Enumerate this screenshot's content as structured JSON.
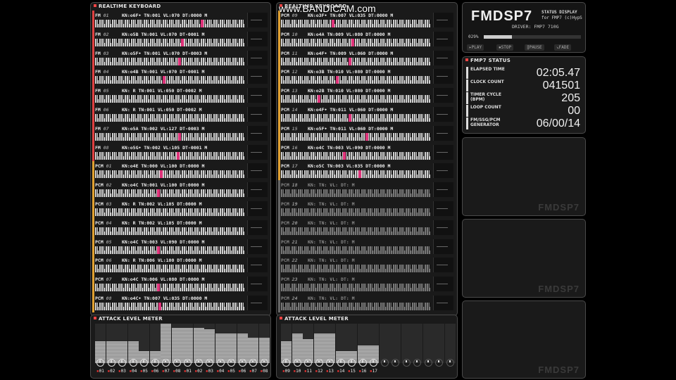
{
  "watermark": "www.BANDICAM.com",
  "left_panel": {
    "title": "REALTIME KEYBOARD",
    "rows": [
      {
        "ch": "FM",
        "num": "01",
        "info": "KN:o6F• TN:001 VL:070 DT:0000 M",
        "color": "#e04040",
        "keys": [
          150
        ]
      },
      {
        "ch": "FM",
        "num": "02",
        "info": "KN:o5B  TN:001 VL:070 DT-0001 M",
        "color": "#e04040",
        "keys": [
          122
        ]
      },
      {
        "ch": "FM",
        "num": "03",
        "info": "KN:o5F• TN:001 VL:070 DT-0003 M",
        "color": "#e04040",
        "keys": [
          118
        ]
      },
      {
        "ch": "FM",
        "num": "04",
        "info": "KN:o4B  TN:001 VL:070 DT-0001 M",
        "color": "#e04040",
        "keys": [
          96
        ]
      },
      {
        "ch": "FM",
        "num": "05",
        "info": "KN: R   TN:001 VL:050 DT-0002 M",
        "color": "#e04040",
        "keys": []
      },
      {
        "ch": "FM",
        "num": "06",
        "info": "KN: R   TN:001 VL:050 DT-0002 M",
        "color": "#e04040",
        "keys": []
      },
      {
        "ch": "FM",
        "num": "07",
        "info": "KN:o5A  TN:002 VL:127 DT-0003 M",
        "color": "#e04040",
        "keys": [
          118
        ]
      },
      {
        "ch": "FM",
        "num": "08",
        "info": "KN:o5G• TN:002 VL:105 DT-0001 M",
        "color": "#e04040",
        "keys": [
          116
        ]
      },
      {
        "ch": "PCM",
        "num": "01",
        "info": "KN:o4E  TN:000 VL:100 DT:0000 M",
        "color": "#e0a030",
        "keys": [
          92
        ]
      },
      {
        "ch": "PCM",
        "num": "02",
        "info": "KN:o4C  TN:001 VL:100 DT:0000 M",
        "color": "#e0a030",
        "keys": [
          88
        ]
      },
      {
        "ch": "PCM",
        "num": "03",
        "info": "KN: R   TN:002 VL:105 DT:0000 M",
        "color": "#e0a030",
        "keys": []
      },
      {
        "ch": "PCM",
        "num": "04",
        "info": "KN: R   TN:002 VL:105 DT:0000 M",
        "color": "#e0a030",
        "keys": []
      },
      {
        "ch": "PCM",
        "num": "05",
        "info": "KN:o4C  TN:003 VL:090 DT:0000 M",
        "color": "#e0a030",
        "keys": [
          88
        ]
      },
      {
        "ch": "PCM",
        "num": "06",
        "info": "KN: R   TN:006 VL:100 DT:0000 M",
        "color": "#e0a030",
        "keys": []
      },
      {
        "ch": "PCM",
        "num": "07",
        "info": "KN:o4C  TN:006 VL:080 DT:0000 M",
        "color": "#e0a030",
        "keys": [
          88
        ]
      },
      {
        "ch": "PCM",
        "num": "08",
        "info": "KN:o4C• TN:007 VL:035 DT:0000 M",
        "color": "#e0a030",
        "keys": [
          90
        ]
      }
    ]
  },
  "right_panel": {
    "title": "REALTIME KEYBOARD",
    "rows": [
      {
        "ch": "PCM",
        "num": "09",
        "info": "KN:o3F• TN:007 VL:035 DT:0000 M",
        "color": "#e0a030",
        "keys": [
          72
        ],
        "dim": false
      },
      {
        "ch": "PCM",
        "num": "10",
        "info": "KN:o4A  TN:009 VL:080 DT:0000 M",
        "color": "#e0a030",
        "keys": [
          100
        ],
        "dim": false
      },
      {
        "ch": "PCM",
        "num": "11",
        "info": "KN:o4F• TN:009 VL:060 DT:0000 M",
        "color": "#e0a030",
        "keys": [
          96
        ],
        "dim": false
      },
      {
        "ch": "PCM",
        "num": "12",
        "info": "KN:o3B  TN:010 VL:080 DT:0000 M",
        "color": "#e0a030",
        "keys": [
          78
        ],
        "dim": false
      },
      {
        "ch": "PCM",
        "num": "13",
        "info": "KN:o2B  TN:010 VL:080 DT:0000 M",
        "color": "#e0a030",
        "keys": [
          52
        ],
        "dim": false
      },
      {
        "ch": "PCM",
        "num": "14",
        "info": "KN:o4F• TN:011 VL:060 DT:0000 M",
        "color": "#e0a030",
        "keys": [
          96
        ],
        "dim": false
      },
      {
        "ch": "PCM",
        "num": "15",
        "info": "KN:o5F• TN:011 VL:060 DT:0000 M",
        "color": "#e0a030",
        "keys": [
          120
        ],
        "dim": false
      },
      {
        "ch": "PCM",
        "num": "16",
        "info": "KN:o4C  TN:003 VL:090 DT:0000 M",
        "color": "#e0a030",
        "keys": [
          88
        ],
        "dim": false
      },
      {
        "ch": "PCM",
        "num": "17",
        "info": "KN:o5C  TN:003 VL:035 DT:0000 M",
        "color": "#e0a030",
        "keys": [
          110
        ],
        "dim": false
      },
      {
        "ch": "PCM",
        "num": "18",
        "info": "KN:    TN:    VL:    DT:     M",
        "color": "#666666",
        "keys": [],
        "dim": true
      },
      {
        "ch": "PCM",
        "num": "19",
        "info": "KN:    TN:    VL:    DT:     M",
        "color": "#666666",
        "keys": [],
        "dim": true
      },
      {
        "ch": "PCM",
        "num": "20",
        "info": "KN:    TN:    VL:    DT:     M",
        "color": "#666666",
        "keys": [],
        "dim": true
      },
      {
        "ch": "PCM",
        "num": "21",
        "info": "KN:    TN:    VL:    DT:     M",
        "color": "#666666",
        "keys": [],
        "dim": true
      },
      {
        "ch": "PCM",
        "num": "22",
        "info": "KN:    TN:    VL:    DT:     M",
        "color": "#666666",
        "keys": [],
        "dim": true
      },
      {
        "ch": "PCM",
        "num": "23",
        "info": "KN:    TN:    VL:    DT:     M",
        "color": "#666666",
        "keys": [],
        "dim": true
      },
      {
        "ch": "PCM",
        "num": "24",
        "info": "KN:    TN:    VL:    DT:     M",
        "color": "#666666",
        "keys": [],
        "dim": true
      }
    ]
  },
  "left_meter": {
    "title": "ATTACK LEVEL METER",
    "levels": [
      0.55,
      0.55,
      0.55,
      0.55,
      0.3,
      0.3,
      1.0,
      0.9,
      0.9,
      0.9,
      0.85,
      0.75,
      0.75,
      0.75,
      0.65,
      0.65
    ],
    "labels": [
      "01",
      "02",
      "03",
      "04",
      "05",
      "06",
      "07",
      "08",
      "01",
      "02",
      "03",
      "04",
      "05",
      "06",
      "07",
      "08"
    ],
    "prefixes": [
      "F",
      "F",
      "F",
      "F",
      "F",
      "F",
      "F",
      "F",
      "P",
      "P",
      "P",
      "P",
      "P",
      "P",
      "P",
      "P"
    ]
  },
  "right_meter": {
    "title": "ATTACK LEVEL METER",
    "levels": [
      0.55,
      0.75,
      0.6,
      0.75,
      0.75,
      0.3,
      0.3,
      0.45,
      0.45
    ],
    "labels": [
      "09",
      "10",
      "11",
      "12",
      "13",
      "14",
      "15",
      "16",
      "17"
    ],
    "active_count": 9,
    "total": 16
  },
  "header": {
    "logo": "FMDSP7",
    "subtitle_1": "STATUS DISPLAY",
    "subtitle_2": "for FMP7 (c)HypS",
    "driver": "DRIVER: FMP7  710G",
    "progress_label": "029%",
    "progress": 0.29,
    "buttons": {
      "play": "▸PLAY",
      "stop": "▪STOP",
      "pause": "‖PAUSE",
      "fade": "↘FADE"
    }
  },
  "status": {
    "title": "FMP7 STATUS",
    "elapsed_label": "ELAPSED TIME",
    "elapsed": "02:05.47",
    "clock_label": "CLOCK COUNT",
    "clock": "041501",
    "timer_label": "TIMER CYCLE\n(BPM)",
    "timer": "205",
    "loop_label": "LOOP COUNT",
    "loop": "00",
    "gen_label": "FM/SSG/PCM\nGENERATOR",
    "gen": "06/00/14"
  },
  "empty_panel_watermark": "FMDSP7"
}
